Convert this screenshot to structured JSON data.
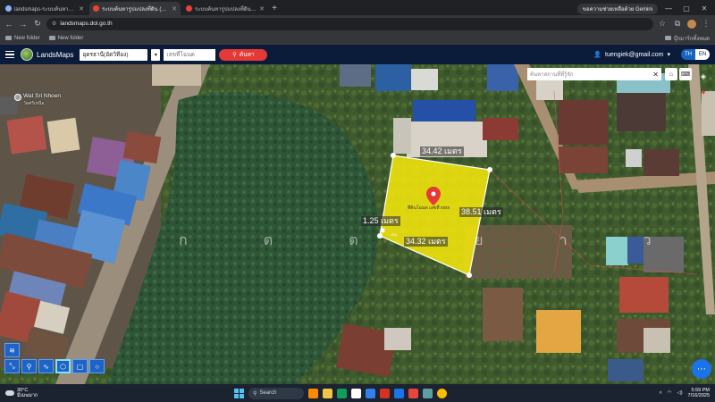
{
  "browser": {
    "tabs": [
      {
        "label": "landsmaps-ระบบค้นหารูปแปลงที่ดิน - ค้นหาด้วยเลขโฉนด",
        "active": false
      },
      {
        "label": "ระบบค้นหารูปแปลงที่ดิน (LandsMaps)",
        "active": true
      },
      {
        "label": "ระบบค้นหารูปแปลงที่ดิน (LandsMaps)",
        "active": false
      }
    ],
    "gemini_pill": "ขอความช่วยเหลือด้วย Gemini",
    "url": "landsmaps.dol.go.th",
    "bookmarks": [
      "New folder",
      "New folder"
    ],
    "bookmarks_right": "บุ๊กมาร์กทั้งหมด"
  },
  "app": {
    "brand": "LandsMaps",
    "province_select": "อุดรธานี(อัดวิทีอง)",
    "deed_input_placeholder": "เลขที่โฉนด",
    "search_label": "ค้นหา",
    "user_email": "tuengiek@gmail.com",
    "lang_th": "TH",
    "lang_en": "EN"
  },
  "map": {
    "search_placeholder": "ค้นหาสถานที่ที่รู้จัก",
    "place_name": "Wat Sri Nhoen",
    "place_sub": "วัดศรีเหนือ",
    "plot_name": "ที่ดินโฉนด เลขที่ xxxx",
    "watermark": "ก ต ต ิ ย า ว",
    "measurements": {
      "top": "34.42 เมตร",
      "right": "38.51 เมตร",
      "bottom": "34.32 เมตร",
      "left": "1.25 เมตร"
    },
    "plot_color": "#f4e60c"
  },
  "taskbar": {
    "temp": "30°C",
    "weather": "มีเมฆมาก",
    "search": "Search",
    "time": "5:59 PM",
    "date": "7/16/2025"
  }
}
